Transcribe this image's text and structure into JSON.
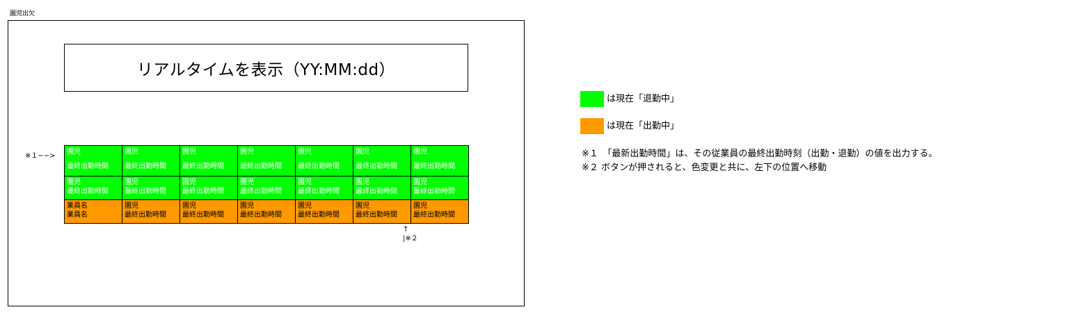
{
  "page_caption": "園児出欠",
  "clock_text": "リアルタイムを表示（YY:MM:dd）",
  "row_note": "※１−−>",
  "grid": {
    "rows": [
      [
        {
          "line1": "園児",
          "line2": "最終出勤時間"
        },
        {
          "line1": "園児",
          "line2": "最終出勤時間"
        },
        {
          "line1": "園児",
          "line2": "最終出勤時間"
        },
        {
          "line1": "園児",
          "line2": "最終出勤時間"
        },
        {
          "line1": "園児",
          "line2": "最終出勤時間"
        },
        {
          "line1": "園児",
          "line2": "最終出勤時間"
        },
        {
          "line1": "園児",
          "line2": "最終出勤時間"
        }
      ],
      [
        {
          "line1": "園児",
          "line2": "最終出勤時間"
        },
        {
          "line1": "園児",
          "line2": "最終出勤時間"
        },
        {
          "line1": "園児",
          "line2": "最終出勤時間"
        },
        {
          "line1": "園児",
          "line2": "最終出勤時間"
        },
        {
          "line1": "園児",
          "line2": "最終出勤時間"
        },
        {
          "line1": "園児",
          "line2": "最終出勤時間"
        },
        {
          "line1": "園児",
          "line2": "最終出勤時間"
        }
      ],
      [
        {
          "line1": "業員名",
          "line2": "業員名"
        },
        {
          "line1": "園児",
          "line2": "最終出勤時間"
        },
        {
          "line1": "園児",
          "line2": "最終出勤時間"
        },
        {
          "line1": "園児",
          "line2": "最終出勤時間"
        },
        {
          "line1": "園児",
          "line2": "最終出勤時間"
        },
        {
          "line1": "園児",
          "line2": "最終出勤時間"
        },
        {
          "line1": "園児",
          "line2": "最終出勤時間"
        }
      ]
    ]
  },
  "move_note": {
    "arrow": "↑",
    "label": "|※２"
  },
  "legend": [
    {
      "color": "#00ff00",
      "text": "は現在「退勤中」"
    },
    {
      "color": "#ff9900",
      "text": "は現在「出勤中」"
    }
  ],
  "notes": [
    "※１　「最新出勤時間」は、その従業員の最終出勤時刻（出勤・退勤）の値を出力する。",
    "※２ ボタンが押されると、色変更と共に、左下の位置へ移動"
  ],
  "colors": {
    "retired": "#00ff00",
    "working": "#ff9900"
  }
}
